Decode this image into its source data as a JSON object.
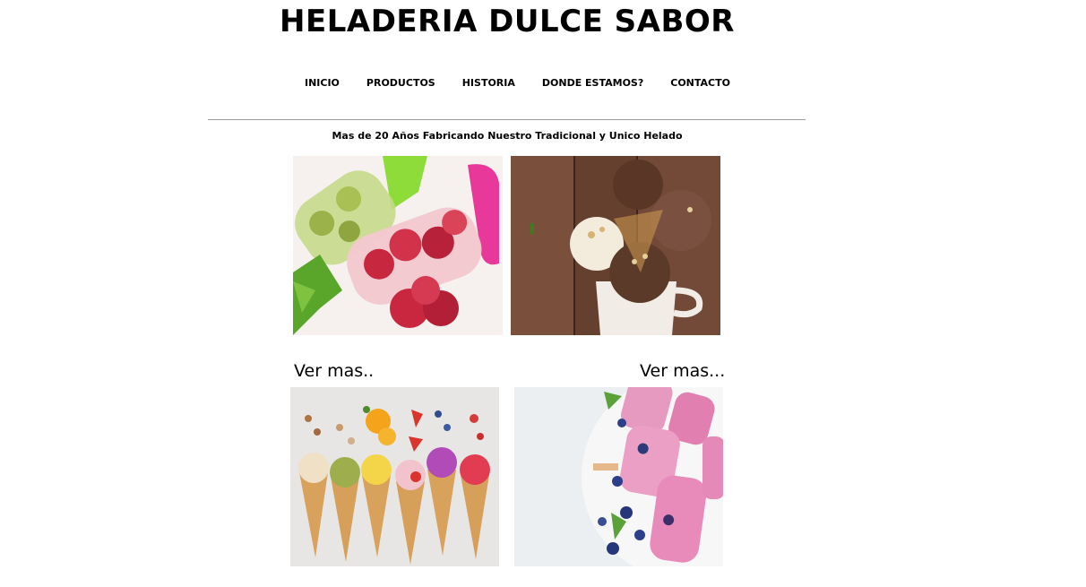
{
  "header": {
    "title": "HELADERIA DULCE SABOR"
  },
  "nav": {
    "items": [
      {
        "label": "INICIO"
      },
      {
        "label": "PRODUCTOS"
      },
      {
        "label": "HISTORIA"
      },
      {
        "label": "DONDE ESTAMOS?"
      },
      {
        "label": "CONTACTO"
      }
    ]
  },
  "tagline": "Mas de 20 Años Fabricando Nuestro Tradicional y Unico Helado",
  "gallery": {
    "links": [
      {
        "label": "Ver mas.."
      },
      {
        "label": "Ver mas..."
      }
    ],
    "photos": [
      {
        "name": "raspberry-kiwi-popsicle-photo"
      },
      {
        "name": "chocolate-ice-cream-cones-photo"
      },
      {
        "name": "ice-cream-cones-fruit-photo"
      },
      {
        "name": "berry-yogurt-popsicles-photo"
      }
    ]
  },
  "colors": {
    "background": "#ffffff",
    "text": "#000000",
    "divider": "#9a9a9a"
  }
}
